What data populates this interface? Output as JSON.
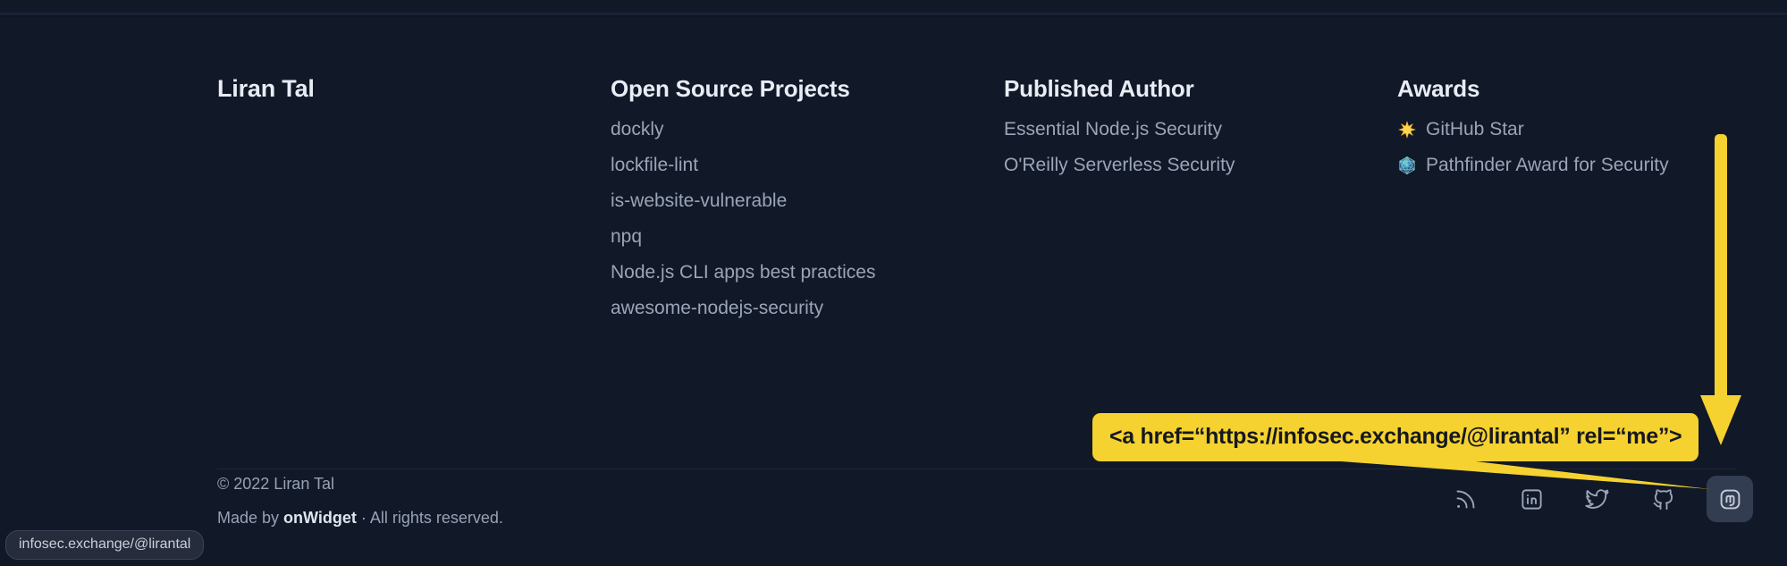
{
  "site": {
    "brand": "Liran Tal",
    "background_color": "#111827",
    "text_muted_color": "#9aa5b8",
    "heading_color": "#e8ecf4",
    "accent_yellow": "#F5D22F"
  },
  "columns": {
    "open_source": {
      "title": "Open Source Projects",
      "links": [
        "dockly",
        "lockfile-lint",
        "is-website-vulnerable",
        "npq",
        "Node.js CLI apps best practices",
        "awesome-nodejs-security"
      ]
    },
    "published_author": {
      "title": "Published Author",
      "links": [
        "Essential Node.js Security",
        "O'Reilly Serverless Security"
      ]
    },
    "awards": {
      "title": "Awards",
      "items": [
        {
          "icon": "glowing-star-icon",
          "label": "GitHub Star"
        },
        {
          "icon": "kaleidoscope-icon",
          "label": "Pathfinder Award for Security"
        }
      ]
    }
  },
  "footer_bottom": {
    "copyright": "© 2022 Liran Tal",
    "made_by_prefix": "Made by ",
    "made_by_brand": "onWidget",
    "made_by_suffix": " · All rights reserved."
  },
  "socials": [
    {
      "icon": "rss-icon",
      "name": "rss"
    },
    {
      "icon": "linkedin-icon",
      "name": "linkedin"
    },
    {
      "icon": "twitter-icon",
      "name": "twitter"
    },
    {
      "icon": "github-icon",
      "name": "github"
    },
    {
      "icon": "mastodon-icon",
      "name": "mastodon",
      "active": true
    }
  ],
  "annotation": {
    "callout_text": "<a href=“https://infosec.exchange/@lirantal” rel=“me”>",
    "arrow": "down-arrow-icon"
  },
  "browser": {
    "status_url": "infosec.exchange/@lirantal"
  }
}
